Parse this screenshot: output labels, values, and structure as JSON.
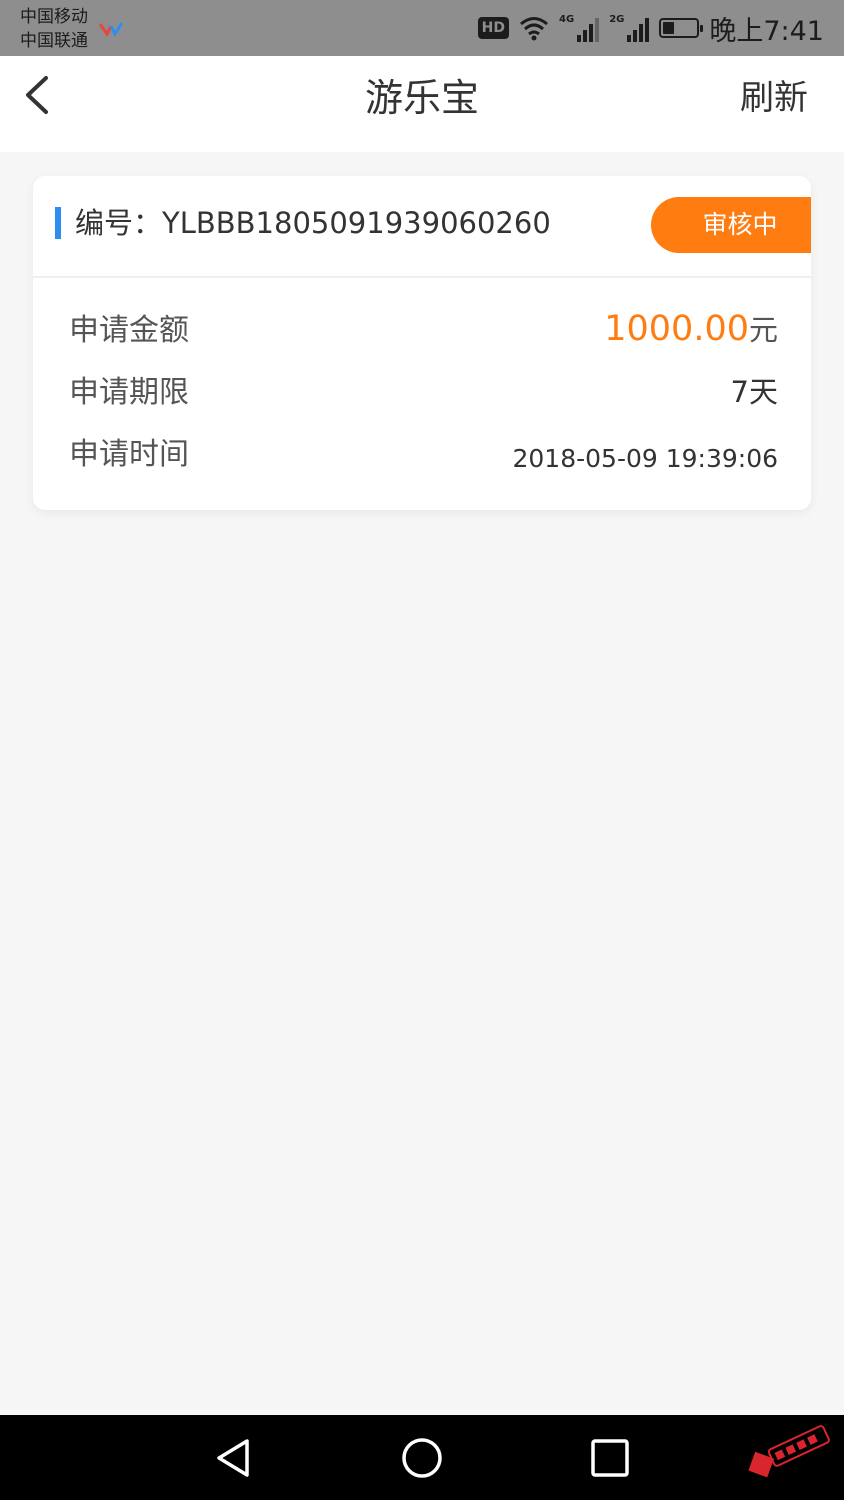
{
  "status_bar": {
    "carrier_1": "中国移动",
    "carrier_2": "中国联通",
    "hd": "HD",
    "net_1": "4G",
    "net_2": "2G",
    "time": "晚上7:41",
    "battery_level": 0.35
  },
  "nav": {
    "title": "游乐宝",
    "refresh_label": "刷新",
    "back_icon": "chevron-left-icon"
  },
  "card": {
    "order_number": "编号：YLBBB1805091939060260",
    "status": "审核中",
    "rows": [
      {
        "label": "申请金额",
        "value": "1000.00",
        "unit": "元"
      },
      {
        "label": "申请期限",
        "value": "7天"
      },
      {
        "label": "申请时间",
        "value": "2018-05-09 19:39:06"
      }
    ]
  },
  "colors": {
    "accent_blue": "#2e8ef0",
    "accent_orange": "#ff7c10",
    "page_bg": "#f6f6f6"
  },
  "system_nav": {
    "back_icon": "triangle-back-icon",
    "home_icon": "circle-home-icon",
    "recents_icon": "square-recents-icon"
  }
}
